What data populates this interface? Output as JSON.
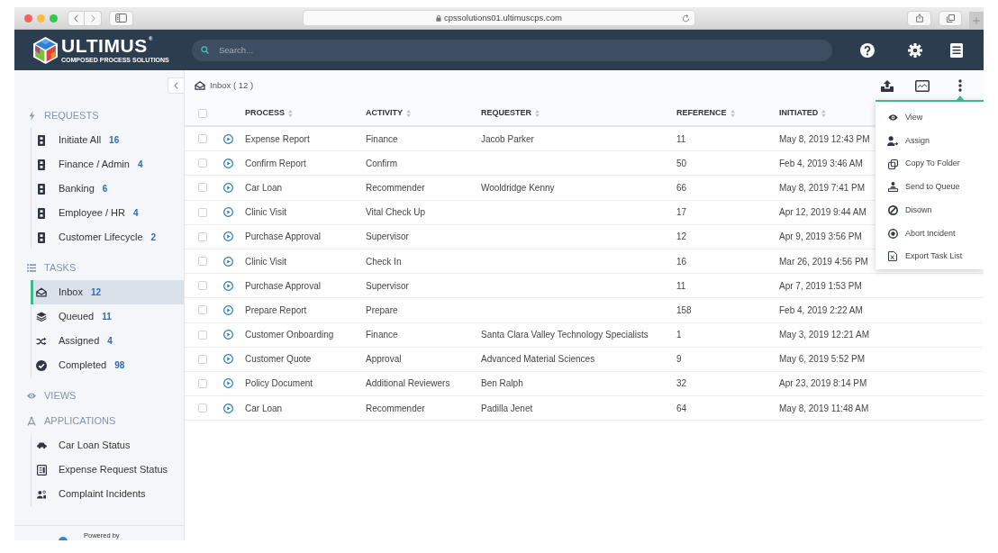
{
  "browser": {
    "address": "cpssolutions01.ultimuscps.com"
  },
  "header": {
    "brand": "ULTIMUS$^{®}$",
    "tagline": "COMPOSED PROCESS SOLUTIONS",
    "search": {
      "placeholder": "Search..."
    }
  },
  "sidebar": {
    "sections": [
      {
        "title": "REQUESTS",
        "items": [
          {
            "label": "Initiate All",
            "count": "16",
            "selected": false
          },
          {
            "label": "Finance / Admin",
            "count": "4",
            "selected": false
          },
          {
            "label": "Banking",
            "count": "6",
            "selected": false
          },
          {
            "label": "Employee / HR",
            "count": "4",
            "selected": false
          },
          {
            "label": "Customer Lifecycle",
            "count": "2",
            "selected": false
          }
        ]
      },
      {
        "title": "TASKS",
        "items": [
          {
            "label": "Inbox",
            "count": "12",
            "selected": true
          },
          {
            "label": "Queued",
            "count": "11",
            "selected": false
          },
          {
            "label": "Assigned",
            "count": "4",
            "selected": false
          },
          {
            "label": "Completed",
            "count": "98",
            "selected": false
          }
        ]
      },
      {
        "title": "VIEWS"
      },
      {
        "title": "APPLICATIONS",
        "items": [
          {
            "label": "Car Loan Status",
            "selected": false
          },
          {
            "label": "Expense Request Status",
            "selected": false
          },
          {
            "label": "Complaint Incidents",
            "selected": false
          }
        ]
      }
    ],
    "footer": "Powered by"
  },
  "inbox": {
    "title": "Inbox ( 12 )",
    "table": {
      "all_checked": false,
      "columns": [
        "PROCESS",
        "ACTIVITY",
        "REQUESTER",
        "REFERENCE",
        "INITIATED"
      ],
      "rows": [
        {
          "checked": false,
          "process": "Expense Report",
          "activity": "Finance",
          "requester": "Jacob Parker",
          "reference": "11",
          "initiated": "May 8, 2019 12:43 PM"
        },
        {
          "checked": false,
          "process": "Confirm Report",
          "activity": "Confirm",
          "reference": "50",
          "initiated": "Feb 4, 2019 3:46 AM"
        },
        {
          "checked": false,
          "process": "Car Loan",
          "activity": "Recommender",
          "requester": "Wooldridge Kenny",
          "reference": "66",
          "initiated": "May 8, 2019 7:41 PM"
        },
        {
          "checked": false,
          "process": "Clinic Visit",
          "activity": "Vital Check Up",
          "reference": "17",
          "initiated": "Apr 12, 2019 9:44 AM"
        },
        {
          "checked": false,
          "process": "Purchase Approval",
          "activity": "Supervisor",
          "reference": "12",
          "initiated": "Apr 9, 2019 3:56 PM"
        },
        {
          "checked": false,
          "process": "Clinic Visit",
          "activity": "Check In",
          "reference": "16",
          "initiated": "Mar 26, 2019 4:56 PM"
        },
        {
          "checked": false,
          "process": "Purchase Approval",
          "activity": "Supervisor",
          "reference": "11",
          "initiated": "Apr 7, 2019 1:53 PM"
        },
        {
          "checked": false,
          "process": "Prepare Report",
          "activity": "Prepare",
          "reference": "158",
          "initiated": "Feb 4, 2019 2:22 AM"
        },
        {
          "checked": false,
          "process": "Customer Onboarding",
          "activity": "Finance",
          "requester": "Santa Clara Valley Technology Specialists",
          "reference": "1",
          "initiated": "May 3, 2019 12:21 AM"
        },
        {
          "checked": false,
          "process": "Customer Quote",
          "activity": "Approval",
          "requester": "Advanced Material Sciences",
          "reference": "9",
          "initiated": "May 6, 2019 5:52 PM"
        },
        {
          "checked": false,
          "process": "Policy Document",
          "activity": "Additional Reviewers",
          "requester": "Ben Ralph",
          "reference": "32",
          "initiated": "Apr 23, 2019 8:14 PM"
        },
        {
          "checked": false,
          "process": "Car Loan",
          "activity": "Recommender",
          "requester": "Padilla Jenet",
          "reference": "64",
          "initiated": "May 8, 2019 11:48 AM"
        }
      ]
    }
  },
  "action_menu": {
    "items": [
      {
        "label": "View"
      },
      {
        "label": "Assign"
      },
      {
        "label": "Copy To Folder"
      },
      {
        "label": "Send to Queue"
      },
      {
        "label": "Disown"
      },
      {
        "label": "Abort Incident"
      },
      {
        "label": "Export Task List"
      }
    ]
  }
}
